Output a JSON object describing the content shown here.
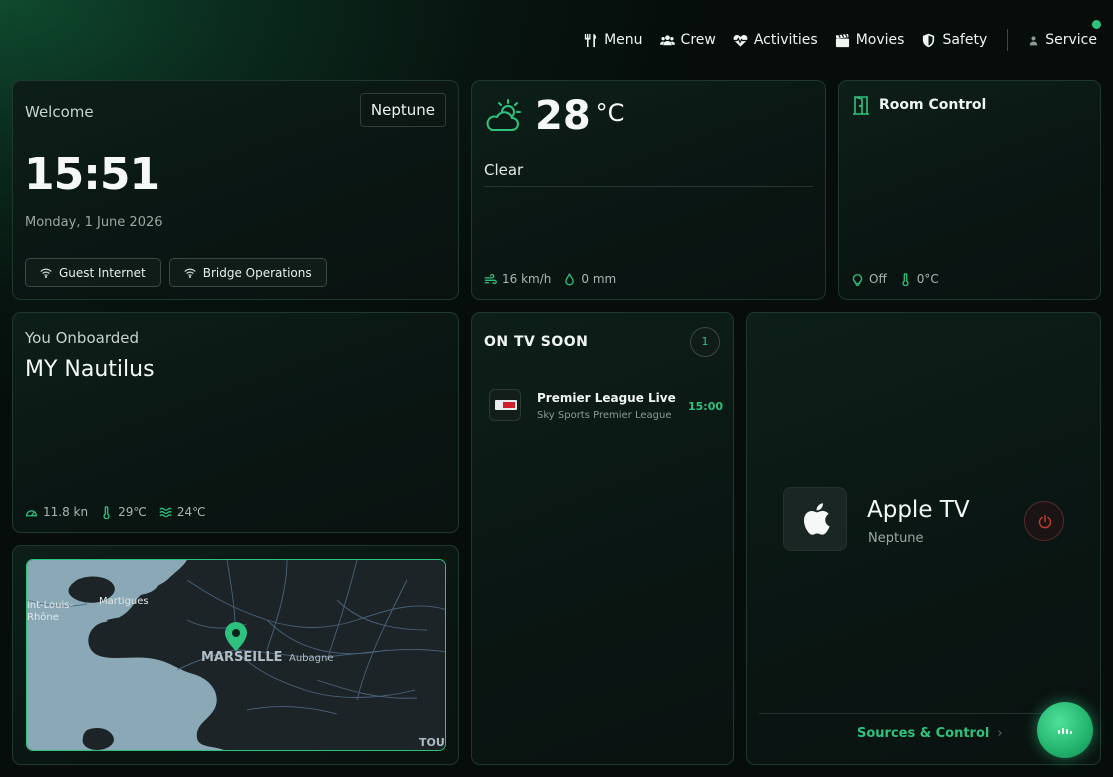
{
  "nav": {
    "items": [
      {
        "label": "Menu",
        "icon": "utensils-icon"
      },
      {
        "label": "Crew",
        "icon": "users-icon"
      },
      {
        "label": "Activities",
        "icon": "heart-pulse-icon"
      },
      {
        "label": "Movies",
        "icon": "clapperboard-icon"
      },
      {
        "label": "Safety",
        "icon": "shield-icon"
      }
    ],
    "service_label": "Service"
  },
  "welcome": {
    "title": "Welcome",
    "location_button": "Neptune",
    "time": "15:51",
    "date": "Monday, 1 June 2026",
    "wifi_buttons": [
      "Guest Internet",
      "Bridge Operations"
    ]
  },
  "weather": {
    "temp": "28",
    "unit": "°C",
    "condition": "Clear",
    "wind": "16 km/h",
    "rain": "0 mm"
  },
  "room": {
    "title": "Room Control",
    "light": "Off",
    "temp": "0°C"
  },
  "onboard": {
    "label": "You Onboarded",
    "vessel": "MY Nautilus",
    "speed": "11.8 kn",
    "air_temp": "29℃",
    "water_temp": "24℃"
  },
  "map": {
    "labels": {
      "marseille": "MARSEILLE",
      "aubagne": "Aubagne",
      "martigues": "Martigues",
      "saint_louis": "int-Louis-",
      "rhone": "Rhône",
      "toulon": "TOU"
    }
  },
  "tv": {
    "title": "ON TV SOON",
    "count": "1",
    "items": [
      {
        "title": "Premier League Live",
        "channel": "Sky Sports Premier League",
        "time": "15:00"
      }
    ]
  },
  "appletv": {
    "name": "Apple TV",
    "room": "Neptune",
    "link": "Sources & Control"
  },
  "colors": {
    "accent": "#2ec27e",
    "background": "#07140f",
    "power": "#c0392b"
  }
}
